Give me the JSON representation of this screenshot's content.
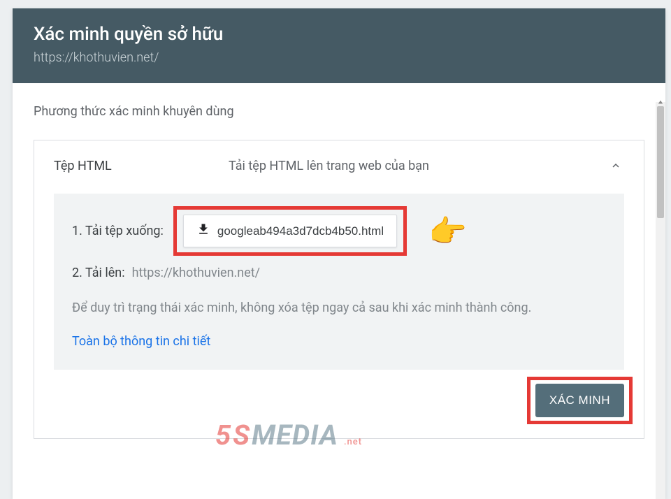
{
  "header": {
    "title": "Xác minh quyền sở hữu",
    "url": "https://khothuvien.net/"
  },
  "section": {
    "recommended_label": "Phương thức xác minh khuyên dùng"
  },
  "method": {
    "name": "Tệp HTML",
    "description": "Tải tệp HTML lên trang web của bạn"
  },
  "steps": {
    "step1_label": "1. Tải tệp xuống:",
    "download_filename": "googleab494a3d7dcb4b50.html",
    "step2_label": "2. Tải lên:",
    "step2_value": "https://khothuvien.net/",
    "note": "Để duy trì trạng thái xác minh, không xóa tệp ngay cả sau khi xác minh thành công.",
    "details_link": "Toàn bộ thông tin chi tiết"
  },
  "buttons": {
    "verify": "XÁC MINH"
  },
  "watermark": {
    "brand_5": "5",
    "brand_s": "S",
    "brand_media": "MEDIA",
    "brand_net": ".net"
  },
  "annotations": {
    "pointer": "👉"
  }
}
